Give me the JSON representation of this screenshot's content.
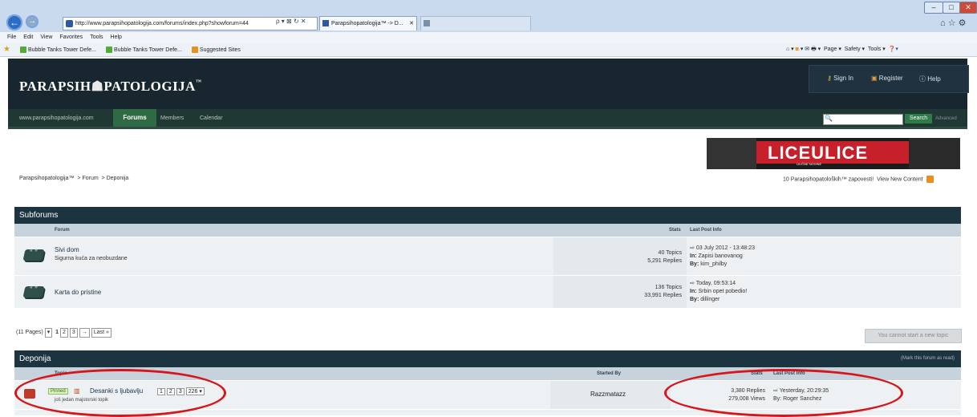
{
  "browser": {
    "url": "http://www.parapsihopatologija.com/forums/index.php?showforum=44",
    "tab_active": "Parapsihopatologija™ -> D...",
    "tab_other": "",
    "menu": [
      "File",
      "Edit",
      "View",
      "Favorites",
      "Tools",
      "Help"
    ],
    "favorites": [
      "Bubble Tanks Tower Defe...",
      "Bubble Tanks Tower Defe...",
      "Suggested Sites"
    ],
    "toolbar": [
      "Page ▾",
      "Safety ▾",
      "Tools ▾"
    ]
  },
  "site": {
    "logo": "PARAPSIH",
    "logo2": "PATOLOGIJA",
    "logo_tm": "™",
    "user_links": {
      "signin": "Sign In",
      "register": "Register",
      "help": "Help"
    },
    "nav": {
      "home": "www.parapsihopatologija.com",
      "forums": "Forums",
      "members": "Members",
      "calendar": "Calendar"
    },
    "search_button": "Search",
    "advanced": "Advanced",
    "banner": {
      "title": "LICEULICE",
      "subtitle": "ULIČNE NOVINE"
    }
  },
  "breadcrumb": {
    "a": "Parapsihopatologija™",
    "b": "Forum",
    "c": "Deponija"
  },
  "topright": {
    "text": "10 Parapsihopatoloških™ zapovesti!",
    "link": "View New Content"
  },
  "subforums": {
    "title": "Subforums",
    "cols": {
      "forum": "Forum",
      "stats": "Stats",
      "lastpost": "Last Post Info"
    },
    "rows": [
      {
        "name": "Sivi dom",
        "desc": "Sigurna kuća za neobuzdane",
        "topics": "40 Topics",
        "replies": "5,291 Replies",
        "date": "03 July 2012 - 13:48:23",
        "in": "Zapisi banovanog",
        "by": "kim_philby"
      },
      {
        "name": "Karta do pristine",
        "desc": "",
        "topics": "136 Topics",
        "replies": "33,991 Replies",
        "date": "Today, 09:53:14",
        "in": "Srbin opet pobedio!",
        "by": "dillinger"
      }
    ]
  },
  "pagination": {
    "label": "(11 Pages)",
    "current": "1",
    "p2": "2",
    "p3": "3",
    "next": "→",
    "last": "Last »"
  },
  "cannot_start": "You cannot start a new topic",
  "deponija": {
    "title": "Deponija",
    "mark_read": "(Mark this forum as read)",
    "cols": {
      "topic": "Topic",
      "started": "Started By",
      "stats": "Stats",
      "lastpost": "Last Post Info"
    },
    "row": {
      "pinned": "Pinned",
      "title": "Desanki s ljubavlju",
      "sub": "još jedan majstorski topik",
      "pages": [
        "1",
        "2",
        "3",
        "226 ▾"
      ],
      "starter": "Razzmatazz",
      "replies": "3,380 Replies",
      "views": "279,008 Views",
      "date": "Yesterday, 20:29:35",
      "by": "Roger Sanchez"
    }
  },
  "colors": {
    "annotation": "#d8151a",
    "header": "#17262f",
    "nav_active": "#2e6a44",
    "category": "#1c3440"
  }
}
